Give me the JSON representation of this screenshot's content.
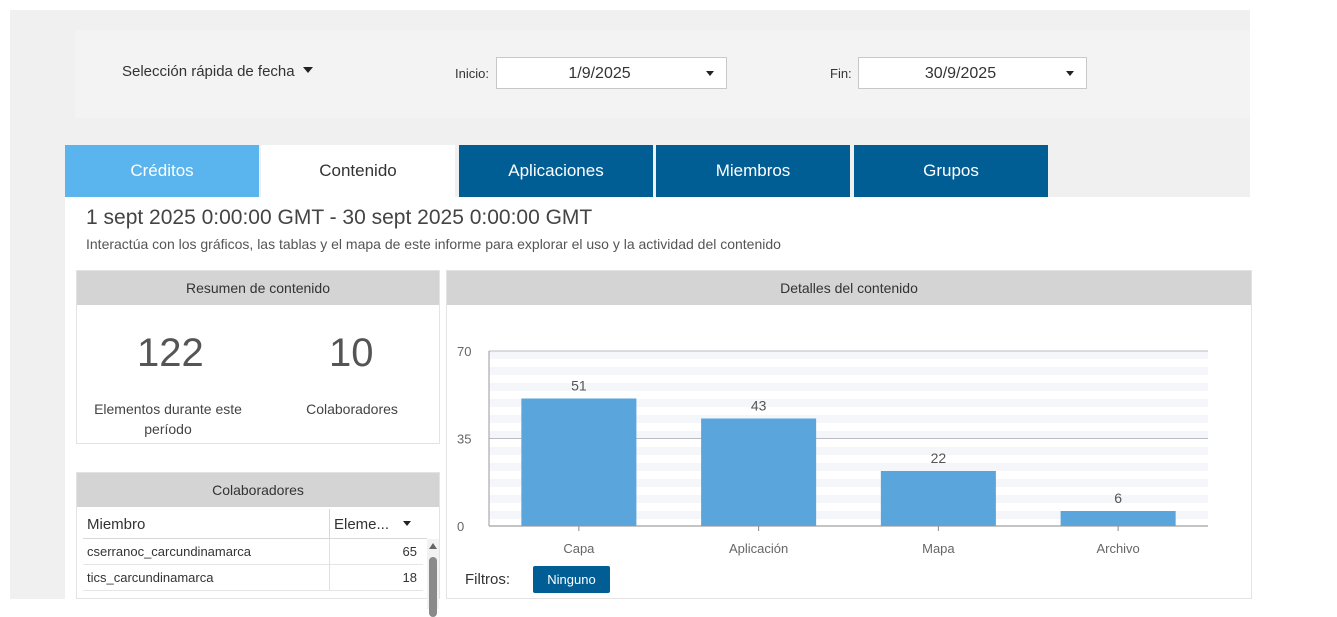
{
  "date_filter": {
    "quick_label": "Selección rápida de fecha",
    "start_label": "Inicio:",
    "start_value": "1/9/2025",
    "end_label": "Fin:",
    "end_value": "30/9/2025"
  },
  "tabs": [
    {
      "label": "Créditos"
    },
    {
      "label": "Contenido"
    },
    {
      "label": "Aplicaciones"
    },
    {
      "label": "Miembros"
    },
    {
      "label": "Grupos"
    }
  ],
  "report": {
    "range": "1 sept 2025 0:00:00 GMT - 30 sept 2025 0:00:00 GMT",
    "description": "Interactúa con los gráficos, las tablas y el mapa de este informe para explorar el uso y la actividad del contenido"
  },
  "summary": {
    "title": "Resumen de contenido",
    "items_value": "122",
    "items_label": "Elementos durante este período",
    "contributors_value": "10",
    "contributors_label": "Colaboradores"
  },
  "contributors_table": {
    "title": "Colaboradores",
    "col_member": "Miembro",
    "col_items": "Eleme...",
    "rows": [
      {
        "member": "cserranoc_carcundinamarca",
        "items": "65"
      },
      {
        "member": "tics_carcundinamarca",
        "items": "18"
      }
    ]
  },
  "details": {
    "title": "Detalles del contenido",
    "filters_label": "Filtros:",
    "filter_value": "Ninguno"
  },
  "chart_data": {
    "type": "bar",
    "categories": [
      "Capa",
      "Aplicación",
      "Mapa",
      "Archivo"
    ],
    "values": [
      51,
      43,
      22,
      6
    ],
    "ylim": [
      0,
      70
    ],
    "yticks": [
      0,
      35,
      70
    ],
    "bar_color": "#5aa5dc",
    "data_labels": true
  },
  "colors": {
    "tab_light": "#5ab4ee",
    "tab_dark": "#005e95",
    "header_gray": "#d4d4d4"
  }
}
